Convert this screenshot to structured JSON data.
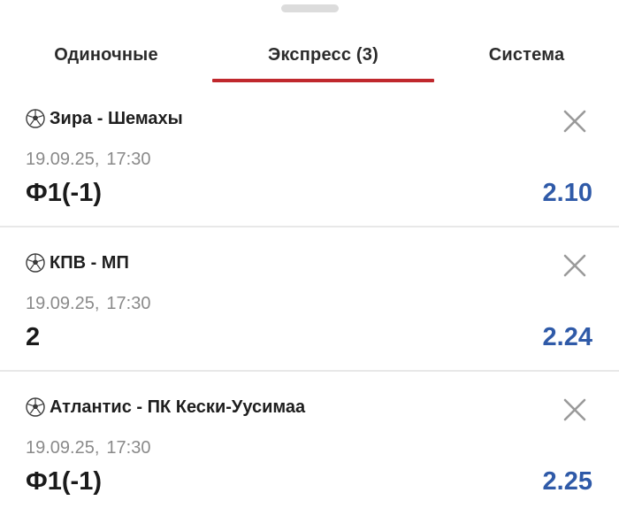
{
  "tabs": [
    {
      "label": "Одиночные",
      "active": false
    },
    {
      "label": "Экспресс (3)",
      "active": true
    },
    {
      "label": "Система",
      "active": false
    }
  ],
  "colors": {
    "accent_underline": "#c0282d",
    "odds": "#2f5aa8",
    "divider": "#e8e8e8",
    "muted_text": "#8a8a8a"
  },
  "bets": [
    {
      "sport_icon": "soccer-ball-icon",
      "match": "Зира - Шемахы",
      "date": "19.09.25,",
      "time": "17:30",
      "outcome": "Ф1(-1)",
      "odds": "2.10",
      "remove_icon": "close-icon"
    },
    {
      "sport_icon": "soccer-ball-icon",
      "match": "КПВ - МП",
      "date": "19.09.25,",
      "time": "17:30",
      "outcome": "2",
      "odds": "2.24",
      "remove_icon": "close-icon"
    },
    {
      "sport_icon": "soccer-ball-icon",
      "match": "Атлантис - ПК Кески-Уусимаа",
      "date": "19.09.25,",
      "time": "17:30",
      "outcome": "Ф1(-1)",
      "odds": "2.25",
      "remove_icon": "close-icon"
    }
  ]
}
